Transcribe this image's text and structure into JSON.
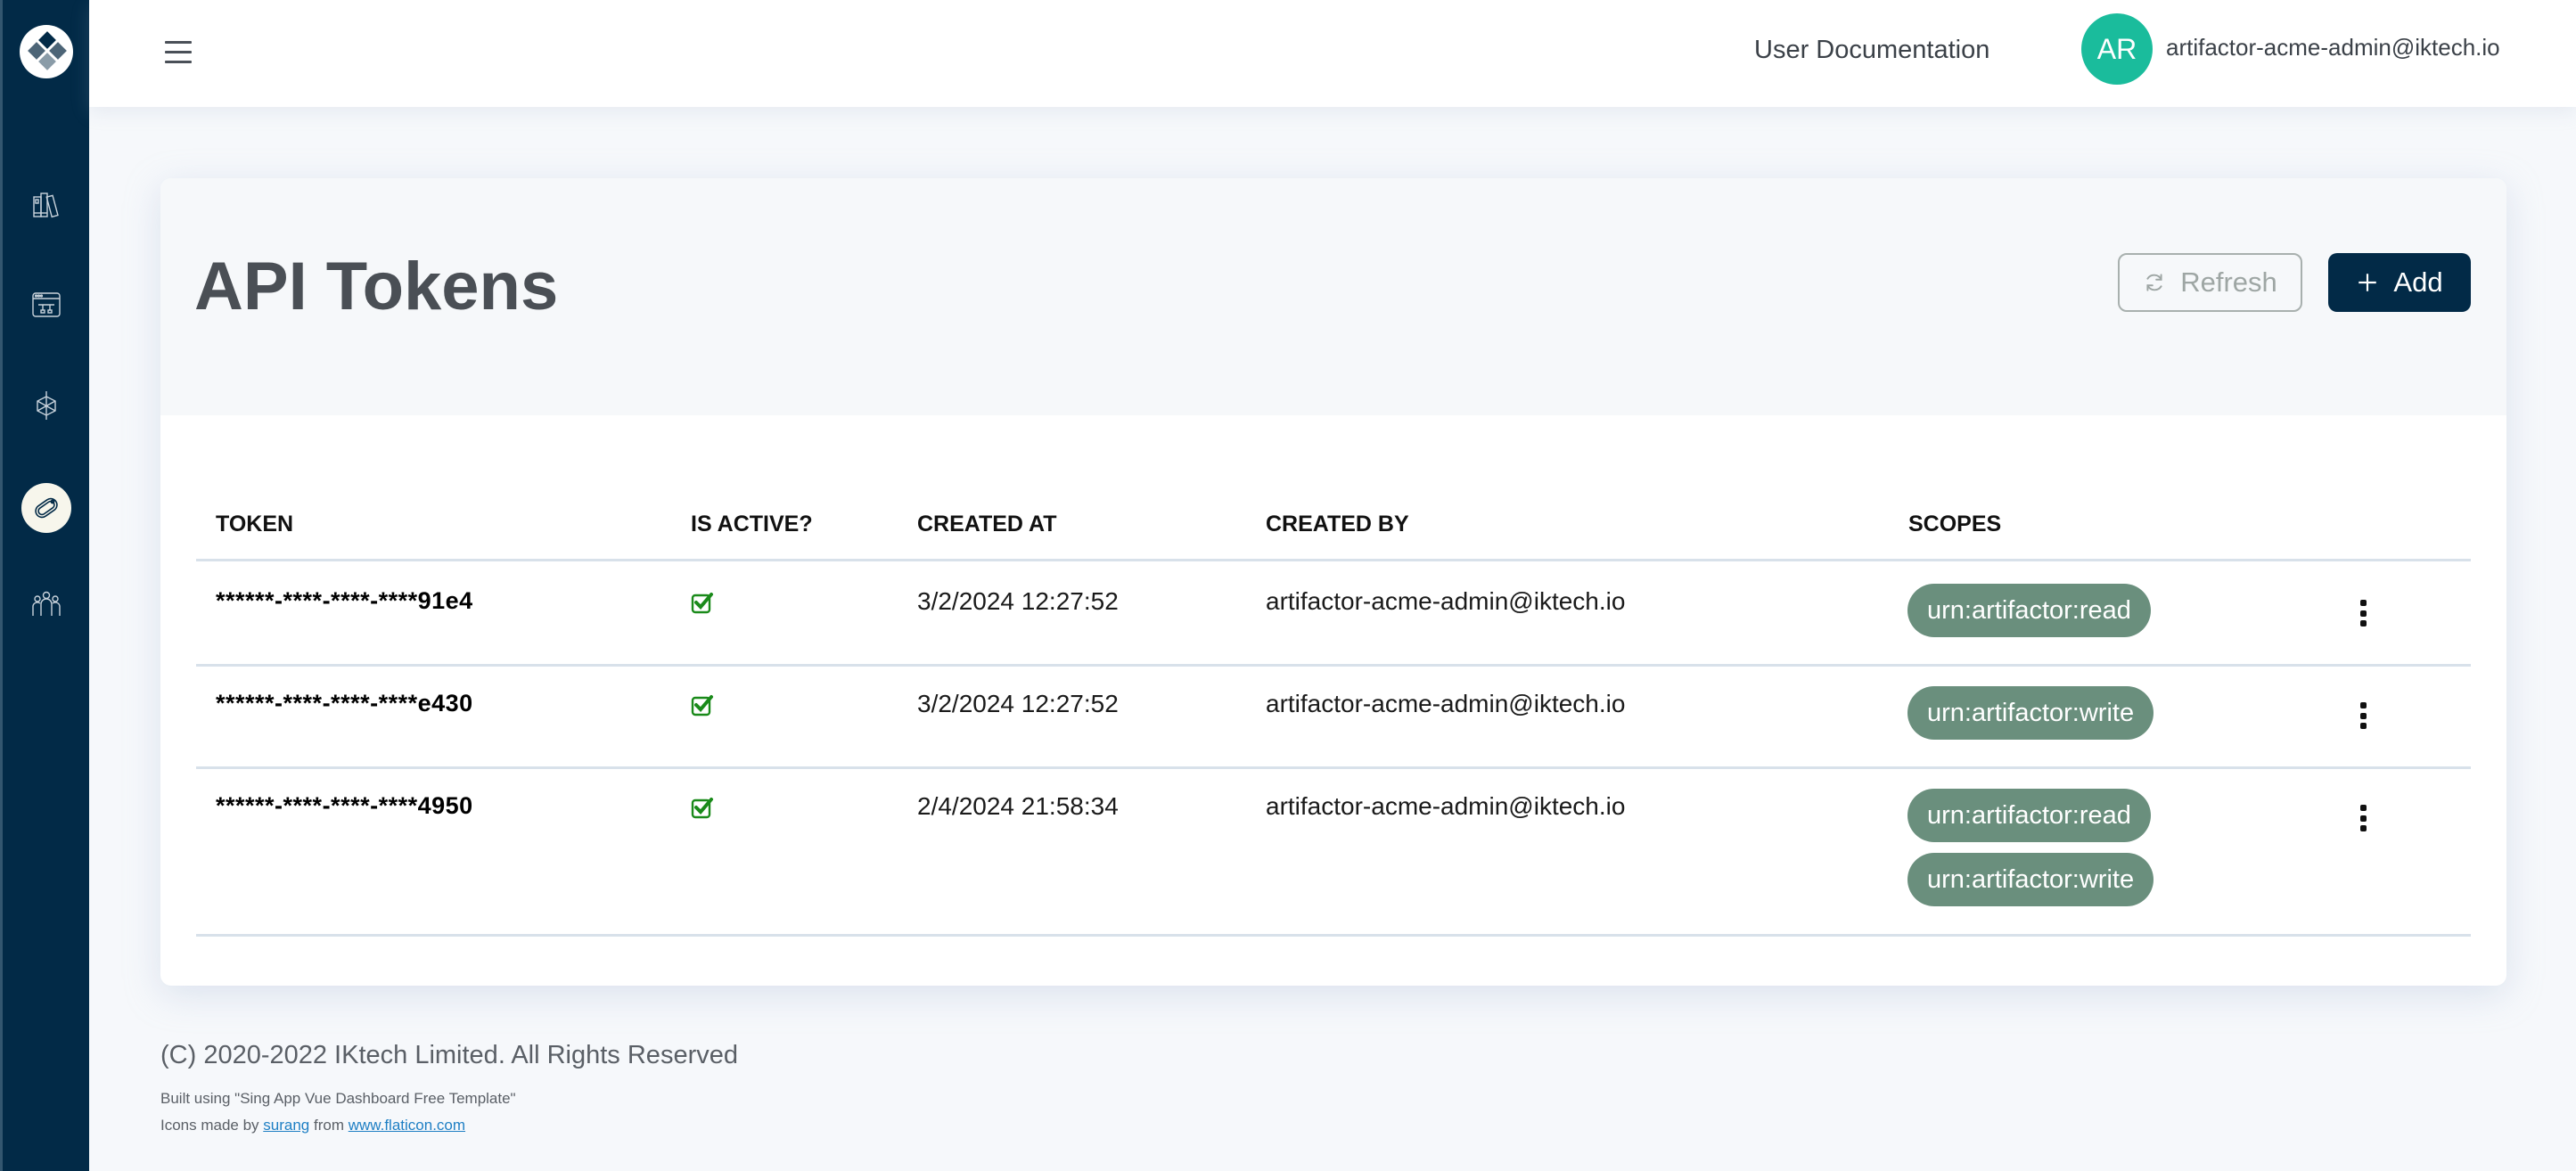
{
  "sidebar": {
    "logo": "diamond-logo-icon",
    "items": [
      {
        "icon": "books-icon",
        "active": false
      },
      {
        "icon": "browser-network-icon",
        "active": false
      },
      {
        "icon": "cube-network-icon",
        "active": false
      },
      {
        "icon": "tag-icon",
        "active": true
      },
      {
        "icon": "team-icon",
        "active": false
      }
    ]
  },
  "header": {
    "menu_icon": "hamburger-icon",
    "doc_link": "User Documentation",
    "avatar_initials": "AR",
    "user_email": "artifactor-acme-admin@iktech.io",
    "avatar_color": "#1abc9c"
  },
  "page": {
    "title": "API Tokens",
    "refresh_label": "Refresh",
    "add_label": "Add",
    "accent_color": "#022a47"
  },
  "table": {
    "columns": [
      "TOKEN",
      "IS ACTIVE?",
      "CREATED AT",
      "CREATED BY",
      "SCOPES"
    ],
    "rows": [
      {
        "token": "******-****-****-****91e4",
        "is_active": true,
        "created_at": "3/2/2024 12:27:52",
        "created_by": "artifactor-acme-admin@iktech.io",
        "scopes": [
          "urn:artifactor:read"
        ]
      },
      {
        "token": "******-****-****-****e430",
        "is_active": true,
        "created_at": "3/2/2024 12:27:52",
        "created_by": "artifactor-acme-admin@iktech.io",
        "scopes": [
          "urn:artifactor:write"
        ]
      },
      {
        "token": "******-****-****-****4950",
        "is_active": true,
        "created_at": "2/4/2024 21:58:34",
        "created_by": "artifactor-acme-admin@iktech.io",
        "scopes": [
          "urn:artifactor:read",
          "urn:artifactor:write"
        ]
      }
    ],
    "scope_chip_color": "#6a8f7d",
    "active_check_color": "#1a8a1a"
  },
  "footer": {
    "copyright": "(C) 2020-2022 IKtech Limited. All Rights Reserved",
    "built_using": "Built using \"Sing App Vue Dashboard Free Template\"",
    "icons_prefix": "Icons made by ",
    "icons_author": "surang",
    "icons_middle": " from ",
    "icons_site": "www.flaticon.com"
  }
}
